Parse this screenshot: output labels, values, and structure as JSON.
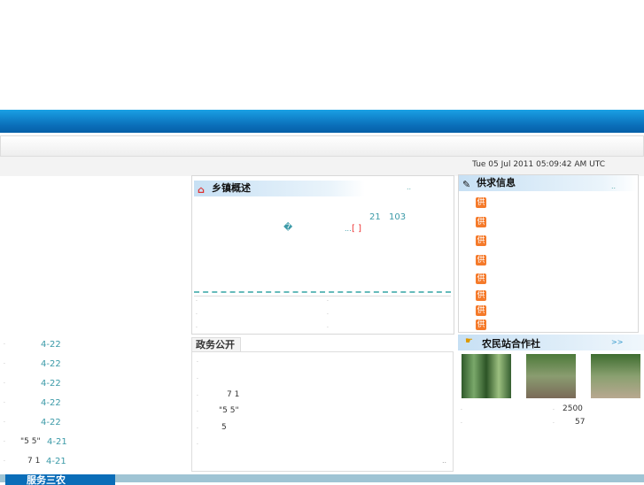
{
  "header": {
    "date": "Tue 05 Jul 2011 05:09:42 AM UTC"
  },
  "town": {
    "title": "乡镇概述",
    "more": "..",
    "num1": "21",
    "num2": "103",
    "glyph": "�",
    "ellipsis": "...",
    "bracket": "[ ]"
  },
  "supply": {
    "title": "供求信息",
    "more": "..",
    "badge": "供",
    "count": 8
  },
  "gov": {
    "title": "政务公开",
    "items": [
      "",
      "",
      "7 1",
      "\"5 5\"",
      "5",
      ""
    ],
    "more": ".."
  },
  "coop": {
    "title": "农民站合作社",
    "more": ">>",
    "stats": [
      "2500",
      "57"
    ]
  },
  "left_list": [
    {
      "text": "",
      "date": "4-22"
    },
    {
      "text": "",
      "date": "4-22"
    },
    {
      "text": "",
      "date": "4-22"
    },
    {
      "text": "",
      "date": "4-22"
    },
    {
      "text": "",
      "date": "4-22"
    },
    {
      "text": "\"5 5\"",
      "date": "4-21"
    },
    {
      "text": "7 1",
      "date": "4-21"
    }
  ],
  "bottom_tab": {
    "label": "服务三农"
  },
  "colors": {
    "banner": "#0a6db8",
    "accent": "#3c9aa8",
    "badge": "#f57a2a"
  }
}
